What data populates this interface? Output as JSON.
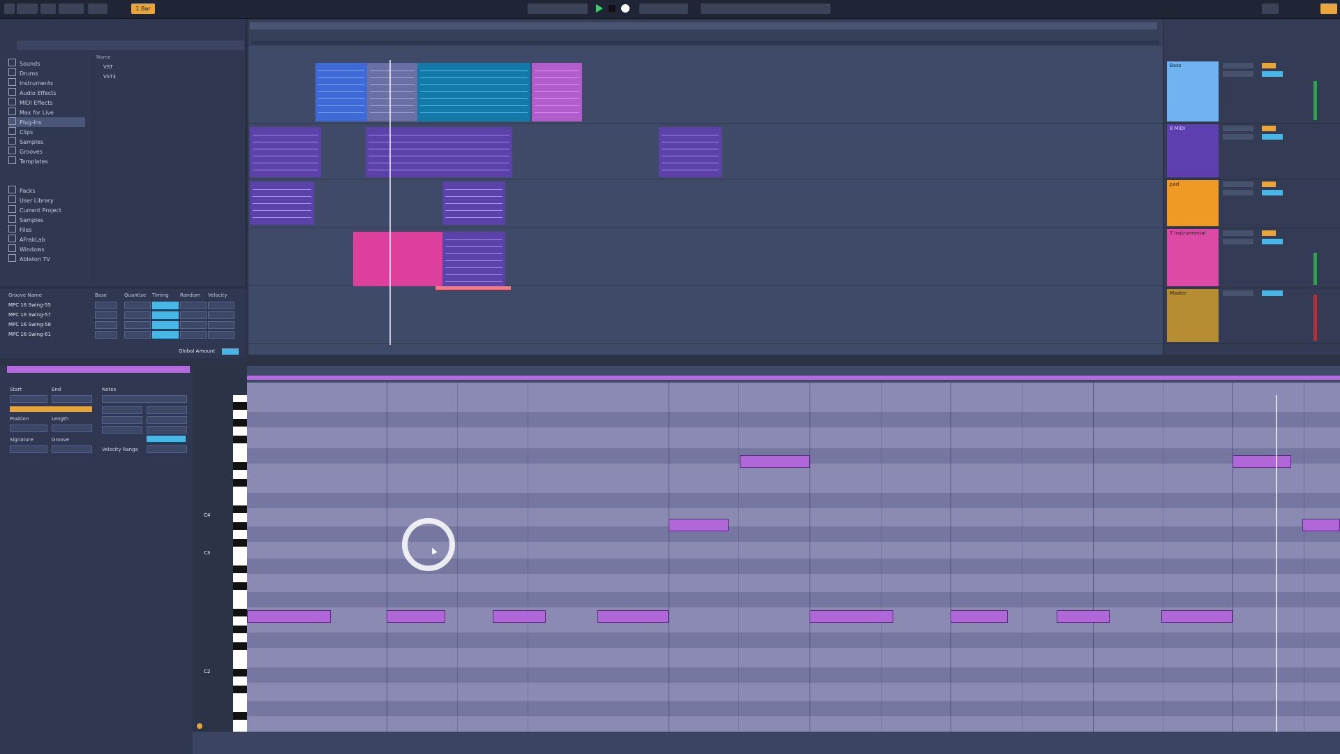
{
  "topbar": {
    "tempo_label": "1 Bar"
  },
  "browser": {
    "categories": [
      "Sounds",
      "Drums",
      "Instruments",
      "Audio Effects",
      "MIDI Effects",
      "Max for Live",
      "Plug-Ins",
      "Clips",
      "Samples",
      "Grooves",
      "Templates"
    ],
    "places": [
      "Packs",
      "User Library",
      "Current Project",
      "Samples",
      "Files",
      "AFrakLab",
      "Windows",
      "Ableton TV"
    ],
    "column_header": "Name",
    "items": [
      "VST",
      "VST3"
    ]
  },
  "groove_pool": {
    "headers": [
      "Groove Name",
      "Base",
      "Quantize",
      "Timing",
      "Random",
      "Velocity"
    ],
    "rows": [
      "MPC 16 Swing-55",
      "MPC 16 Swing-57",
      "MPC 16 Swing-58",
      "MPC 16 Swing-61"
    ],
    "global_amount": "Global Amount"
  },
  "tracks": [
    {
      "name": "Bass",
      "color": "#6fb4f0"
    },
    {
      "name": "8 MIDI",
      "color": "#5d3fb0"
    },
    {
      "name": "pad",
      "color": "#ee9a25"
    },
    {
      "name": "7 Instrumental",
      "color": "#dd4aa6"
    },
    {
      "name": "Master",
      "color": "#b78d33"
    }
  ],
  "clip_view": {
    "labels": [
      "Start",
      "End",
      "Position",
      "Length",
      "Signature",
      "Groove",
      "Notes",
      "Velocity Range"
    ]
  },
  "piano_roll": {
    "key_labels": [
      "C4",
      "C3",
      "C2"
    ]
  }
}
